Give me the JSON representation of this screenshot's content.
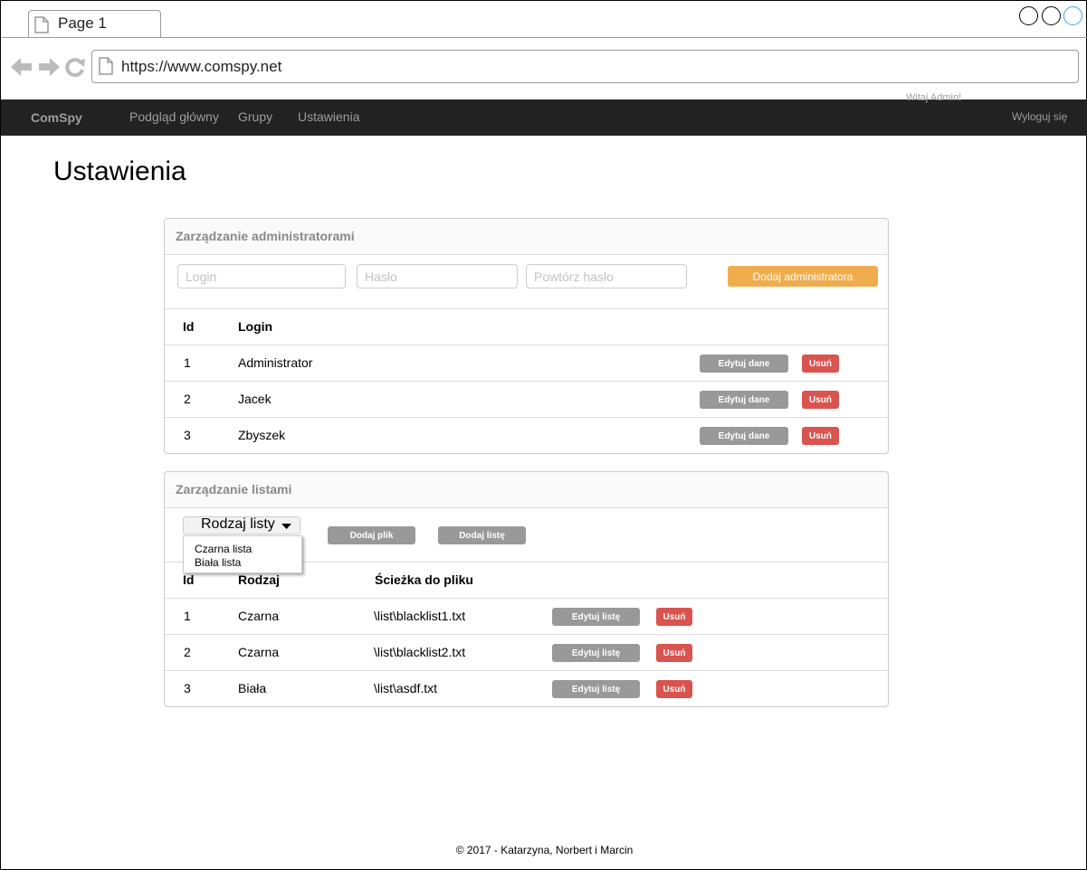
{
  "browser": {
    "tab_label": "Page 1",
    "url": "https://www.comspy.net"
  },
  "navbar": {
    "brand": "ComSpy",
    "items": [
      "Podgląd główny",
      "Grupy",
      "Ustawienia"
    ],
    "greeting": "Witaj Admin!",
    "logout": "Wyloguj się"
  },
  "page": {
    "title": "Ustawienia"
  },
  "admins_panel": {
    "title": "Zarządzanie administratorami",
    "login_placeholder": "Login",
    "password_placeholder": "Hasło",
    "repeat_password_placeholder": "Powtórz hasło",
    "add_button": "Dodaj administratora",
    "columns": [
      "Id",
      "Login"
    ],
    "rows": [
      {
        "id": "1",
        "login": "Administrator"
      },
      {
        "id": "2",
        "login": "Jacek"
      },
      {
        "id": "3",
        "login": "Zbyszek"
      }
    ],
    "edit_label": "Edytuj dane",
    "delete_label": "Usuń"
  },
  "lists_panel": {
    "title": "Zarządzanie listami",
    "dropdown_label": "Rodzaj listy",
    "dropdown_options": [
      "Czarna lista",
      "Biała lista"
    ],
    "add_file_button": "Dodaj plik",
    "add_list_button": "Dodaj listę",
    "columns": [
      "Id",
      "Rodzaj",
      "Ścieżka do pliku"
    ],
    "rows": [
      {
        "id": "1",
        "type": "Czarna",
        "path": "\\list\\blacklist1.txt"
      },
      {
        "id": "2",
        "type": "Czarna",
        "path": "\\list\\blacklist2.txt"
      },
      {
        "id": "3",
        "type": "Biała",
        "path": "\\list\\asdf.txt"
      }
    ],
    "edit_label": "Edytuj listę",
    "delete_label": "Usuń"
  },
  "footer": {
    "text": "© 2017 - Katarzyna, Norbert i Marcin"
  },
  "colors": {
    "navbar_bg": "#222222",
    "nav_text": "#9d9d9d",
    "accent_orange": "#f0ad4e",
    "danger_red": "#d9534f",
    "neutral_gray": "#999999"
  }
}
